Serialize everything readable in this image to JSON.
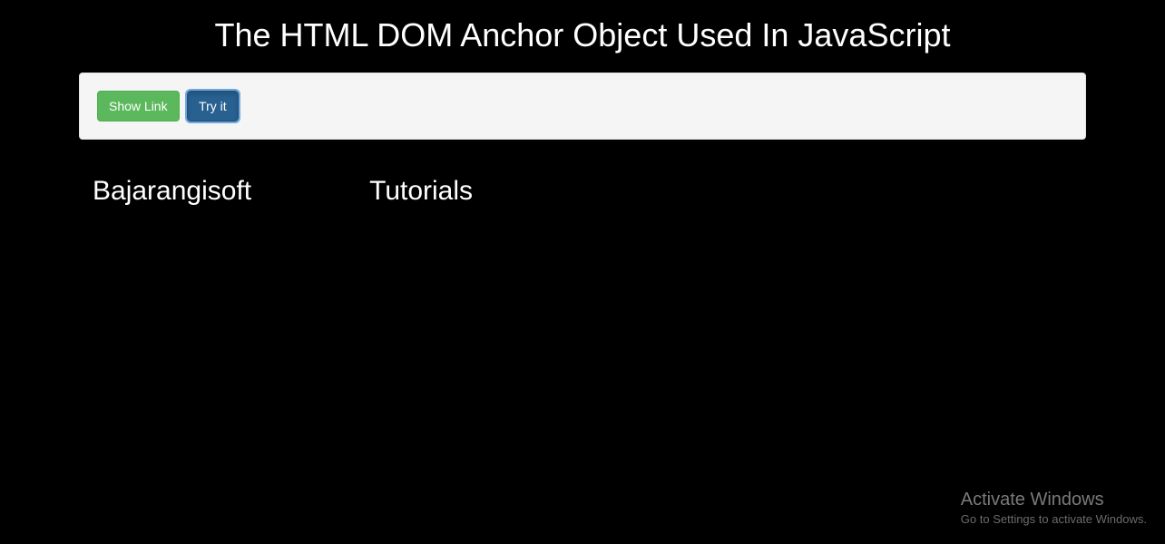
{
  "page": {
    "title": "The HTML DOM Anchor Object Used In JavaScript"
  },
  "buttons": {
    "show_link": "Show Link",
    "try_it": "Try it"
  },
  "results": {
    "item1": "Bajarangisoft",
    "item2": "Tutorials"
  },
  "watermark": {
    "title": "Activate Windows",
    "subtitle": "Go to Settings to activate Windows."
  }
}
